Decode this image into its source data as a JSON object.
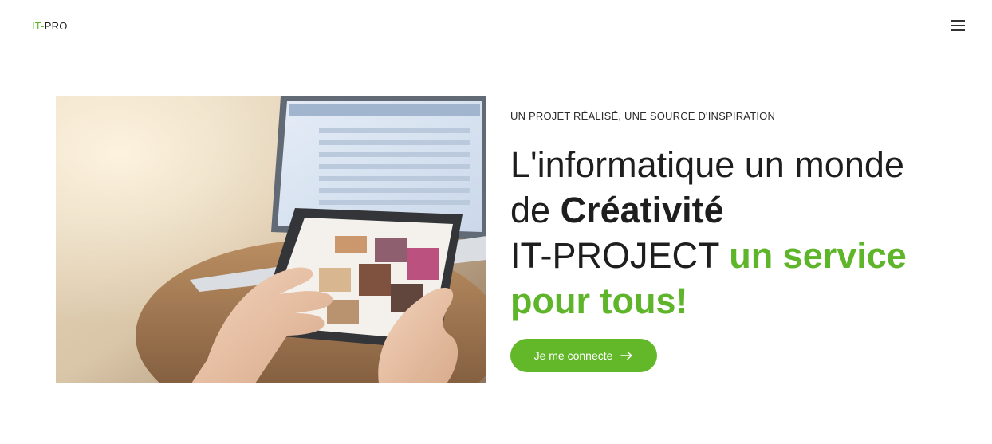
{
  "header": {
    "logo_prefix": "IT-",
    "logo_suffix": "PRO",
    "menu_icon": "hamburger-menu-icon"
  },
  "hero": {
    "eyebrow": "UN PROJET RÉALISÉ, UNE SOURCE D'INSPIRATION",
    "headline_line1": "L'informatique un monde",
    "headline_line2_prefix": "de ",
    "headline_line2_bold": "Créativité",
    "headline_line3_prefix": "IT-PROJECT ",
    "headline_line3_green": "un service",
    "headline_line4_green": "pour tous!",
    "cta_label": "Je me connecte",
    "cta_icon": "arrow-right-icon",
    "image_subject": "hands-using-tablet-photo"
  },
  "colors": {
    "accent": "#63b82a",
    "text": "#1e1e1e",
    "background": "#ffffff"
  }
}
